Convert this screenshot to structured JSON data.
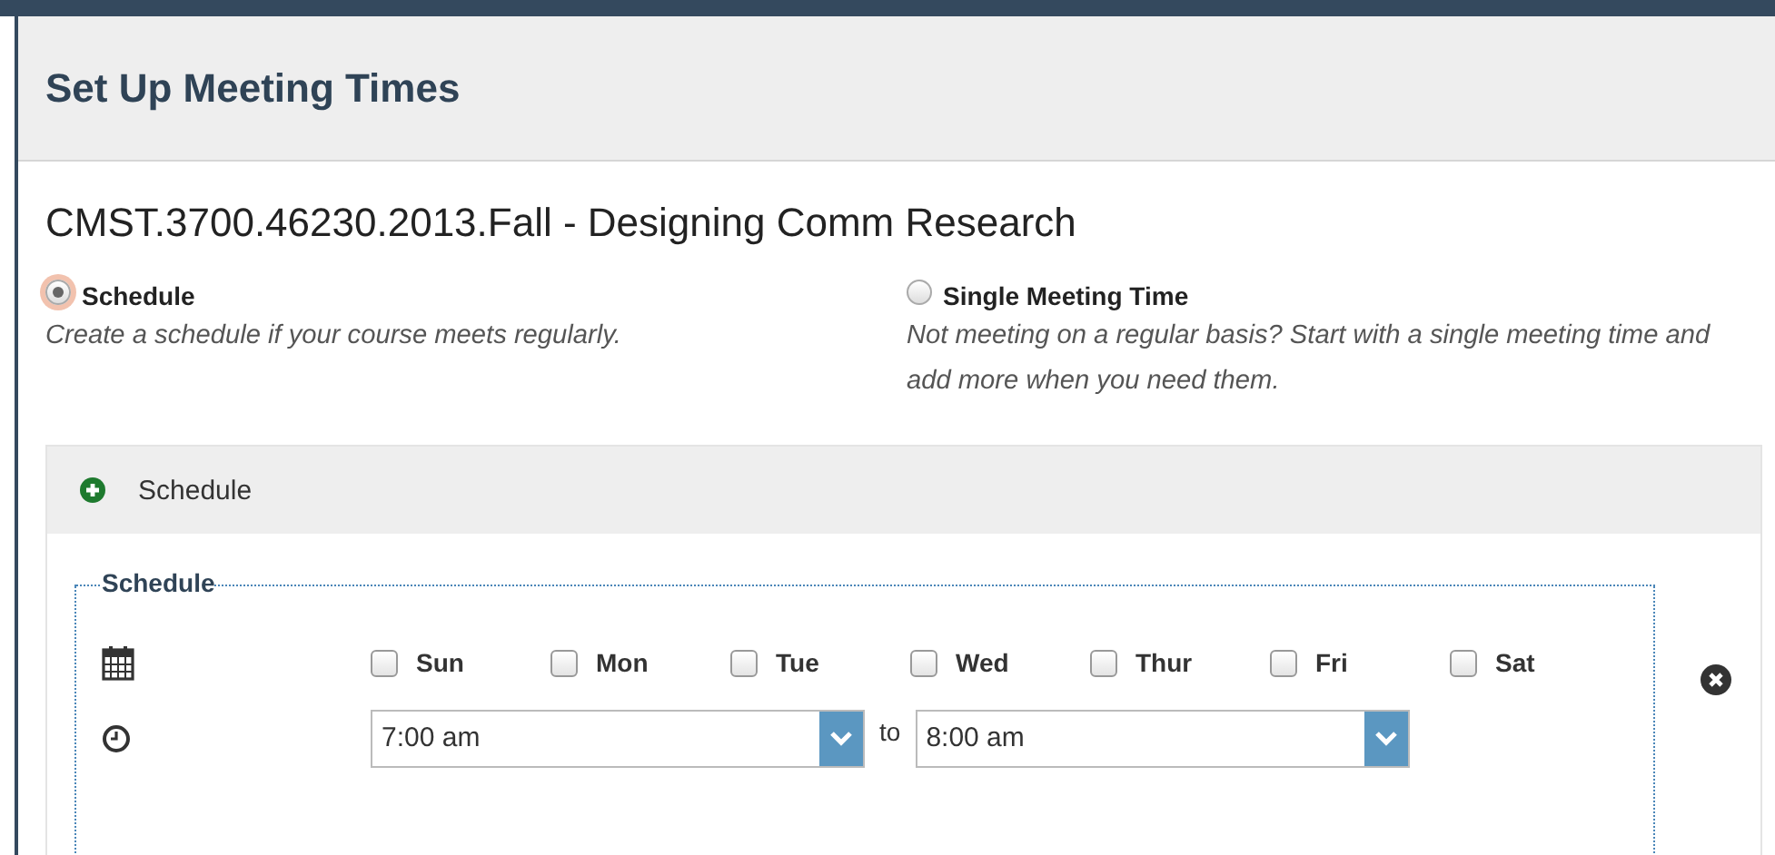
{
  "dialog": {
    "title": "Set Up Meeting Times"
  },
  "course": "CMST.3700.46230.2013.Fall - Designing Comm Research",
  "options": [
    {
      "label": "Schedule",
      "description": "Create a schedule if your course meets regularly.",
      "selected": true
    },
    {
      "label": "Single Meeting Time",
      "description": "Not meeting on a regular basis? Start with a single meeting time and add more when you need them.",
      "selected": false
    }
  ],
  "add_panel": {
    "label": "Schedule"
  },
  "schedule": {
    "legend": "Schedule",
    "days": [
      {
        "label": "Sun",
        "checked": false
      },
      {
        "label": "Mon",
        "checked": false
      },
      {
        "label": "Tue",
        "checked": false
      },
      {
        "label": "Wed",
        "checked": false
      },
      {
        "label": "Thur",
        "checked": false
      },
      {
        "label": "Fri",
        "checked": false
      },
      {
        "label": "Sat",
        "checked": false
      }
    ],
    "start": "7:00 am",
    "separator": "to",
    "end": "8:00 am"
  }
}
